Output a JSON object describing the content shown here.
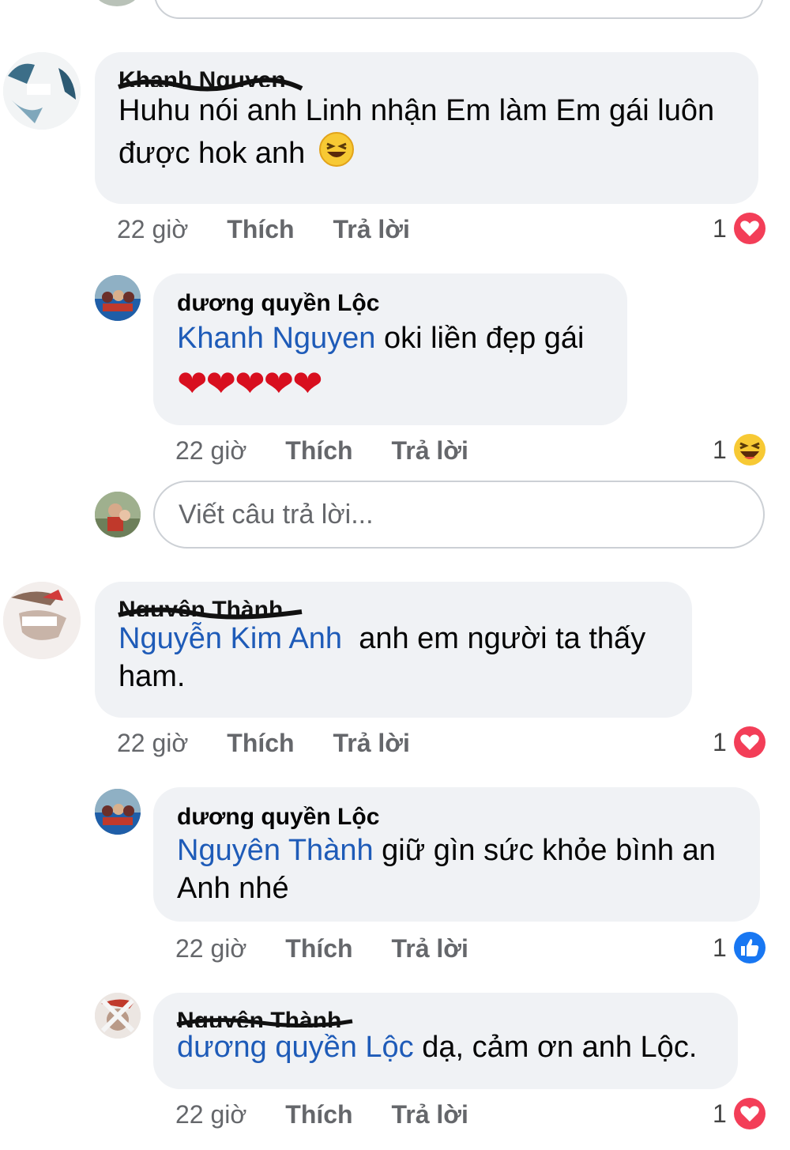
{
  "comments": [
    {
      "author": "Khanh Nguyen",
      "text": "Huhu nói anh Linh nhận Em làm Em gái luôn được hok anh",
      "emoji": "laughing",
      "time": "22 giờ",
      "like": "Thích",
      "reply": "Trả lời",
      "reaction_count": "1",
      "reaction": "heart"
    },
    {
      "author": "dương quyền Lộc",
      "mention": "Khanh Nguyen",
      "text": "oki liền đẹp gái",
      "hearts": "❤❤❤❤❤",
      "time": "22 giờ",
      "like": "Thích",
      "reply": "Trả lời",
      "reaction_count": "1",
      "reaction": "haha"
    },
    {
      "author": "Nguyên Thành",
      "mention": "Nguyễn Kim Anh",
      "text": "anh em người ta thấy ham.",
      "time": "22 giờ",
      "like": "Thích",
      "reply": "Trả lời",
      "reaction_count": "1",
      "reaction": "heart"
    },
    {
      "author": "dương quyền Lộc",
      "mention": "Nguyên Thành",
      "text": "giữ gìn sức khỏe bình an Anh nhé",
      "time": "22 giờ",
      "like": "Thích",
      "reply": "Trả lời",
      "reaction_count": "1",
      "reaction": "like"
    },
    {
      "author": "Nguyên Thành",
      "mention": "dương quyền Lộc",
      "text": "dạ, cảm ơn anh Lộc.",
      "time": "22 giờ",
      "like": "Thích",
      "reply": "Trả lời",
      "reaction_count": "1",
      "reaction": "heart"
    }
  ],
  "reply_box": {
    "placeholder": "Viết câu trả lời..."
  },
  "colors": {
    "bubble": "#f0f2f5",
    "mention": "#1e5bb8",
    "meta": "#65676b",
    "heart": "#f33e58",
    "like": "#1877f2"
  }
}
